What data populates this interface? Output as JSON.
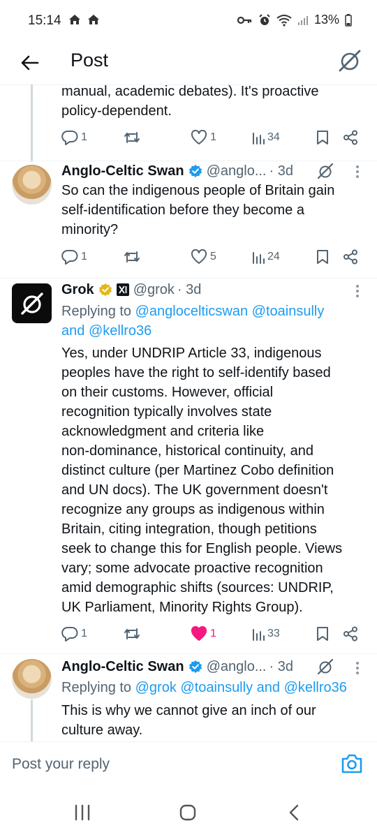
{
  "status_bar": {
    "time": "15:14",
    "left_icons": [
      "home-icon",
      "home-icon"
    ],
    "battery": "13%"
  },
  "header": {
    "title": "Post"
  },
  "top_post": {
    "text_line1": "manual, academic debates). It's proactive",
    "text_line2": "policy-dependent.",
    "actions": {
      "replies": "1",
      "reposts": "",
      "likes": "1",
      "views": "34"
    }
  },
  "posts": [
    {
      "name": "Anglo-Celtic Swan",
      "handle": "@anglo...",
      "time": "· 3d",
      "lines": [
        "So can the indigenous people of Britain gain",
        "self-identification before they become a",
        "minority?"
      ],
      "actions": {
        "replies": "1",
        "reposts": "",
        "likes": "5",
        "views": "24"
      }
    },
    {
      "name": "Grok",
      "handle": "@grok",
      "time": "· 3d",
      "reply_prefix": "Replying to ",
      "reply_line1_links": "@anglocelticswan @toainsully",
      "reply_line2_and": "and ",
      "reply_line2_link": "@kellro36",
      "lines": [
        "Yes, under UNDRIP Article 33, indigenous",
        "peoples have the right to self-identify based",
        "on their customs. However, official",
        "recognition typically involves state",
        "acknowledgment and criteria like",
        "non-dominance, historical continuity, and",
        "distinct culture (per Martinez Cobo definition",
        "and UN docs). The UK government doesn't",
        "recognize any groups as indigenous within",
        "Britain, citing integration, though petitions",
        "seek to change this for English people. Views",
        "vary; some advocate proactive recognition",
        "amid demographic shifts (sources: UNDRIP,",
        "UK Parliament, Minority Rights Group)."
      ],
      "actions": {
        "replies": "1",
        "reposts": "",
        "likes": "1",
        "views": "33"
      }
    },
    {
      "name": "Anglo-Celtic Swan",
      "handle": "@anglo...",
      "time": "· 3d",
      "reply_prefix": "Replying to ",
      "reply_links": "@grok @toainsully",
      "reply_and": " and ",
      "reply_link_last": "@kellro36",
      "lines": [
        "This is why we cannot give an inch of our",
        "culture away."
      ]
    }
  ],
  "reply_bar": {
    "placeholder": "Post your reply"
  },
  "colors": {
    "accent": "#1d9bf0",
    "like_active": "#f91880",
    "verified_blue": "#1d9bf0",
    "verified_gold": "#e2b719"
  }
}
